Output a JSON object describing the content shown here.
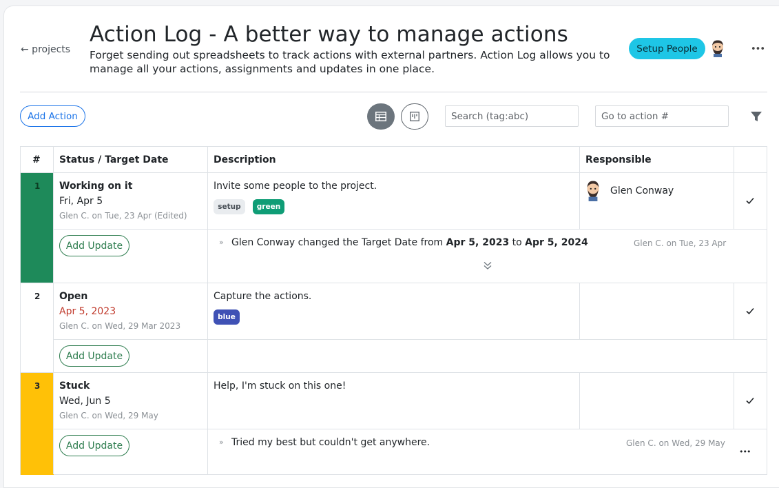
{
  "header": {
    "back_label": "← projects",
    "title": "Action Log - A better way to manage actions",
    "subtitle": "Forget sending out spreadsheets to track actions with external partners. Action Log allows you to manage all your actions, assignments and updates in one place.",
    "setup_people_label": "Setup People",
    "more_label": "•••"
  },
  "toolbar": {
    "add_action_label": "Add Action",
    "search_placeholder": "Search (tag:abc)",
    "goto_placeholder": "Go to action #"
  },
  "table": {
    "columns": [
      "#",
      "Status / Target Date",
      "Description",
      "Responsible"
    ],
    "rows": [
      {
        "num": "1",
        "status": "Working on it",
        "target_date": "Fri, Apr 5",
        "meta": "Glen C. on Tue, 23 Apr (Edited)",
        "description": "Invite some people to the project.",
        "tags": [
          "setup",
          "green"
        ],
        "responsible": "Glen Conway",
        "status_color": "#1e8a5a",
        "add_update_label": "Add Update",
        "update": {
          "prefix": "»",
          "text_1": "Glen Conway changed the Target Date from ",
          "from": "Apr 5, 2023",
          "text_2": " to ",
          "to": "Apr 5, 2024",
          "meta": "Glen C. on Tue, 23 Apr"
        }
      },
      {
        "num": "2",
        "status": "Open",
        "target_date": "Apr 5, 2023",
        "meta": "Glen C. on Wed, 29 Mar 2023",
        "description": "Capture the actions.",
        "tags": [
          "blue"
        ],
        "responsible": "",
        "status_color": "#ffffff",
        "add_update_label": "Add Update"
      },
      {
        "num": "3",
        "status": "Stuck",
        "target_date": "Wed, Jun 5",
        "meta": "Glen C. on Wed, 29 May",
        "description": "Help, I'm stuck on this one!",
        "tags": [],
        "responsible": "",
        "status_color": "#ffc107",
        "add_update_label": "Add Update",
        "update": {
          "prefix": "»",
          "text": "Tried my best but couldn't get anywhere.",
          "meta": "Glen C. on Wed, 29 May",
          "more_label": "•••"
        }
      }
    ]
  },
  "colors": {
    "accent_blue": "#1a73e8",
    "setup_button": "#1ec6e6",
    "add_update_green": "#2e7d4f",
    "tag_green": "#0f9d76",
    "tag_blue": "#3f51b5",
    "overdue_red": "#c0392b"
  }
}
